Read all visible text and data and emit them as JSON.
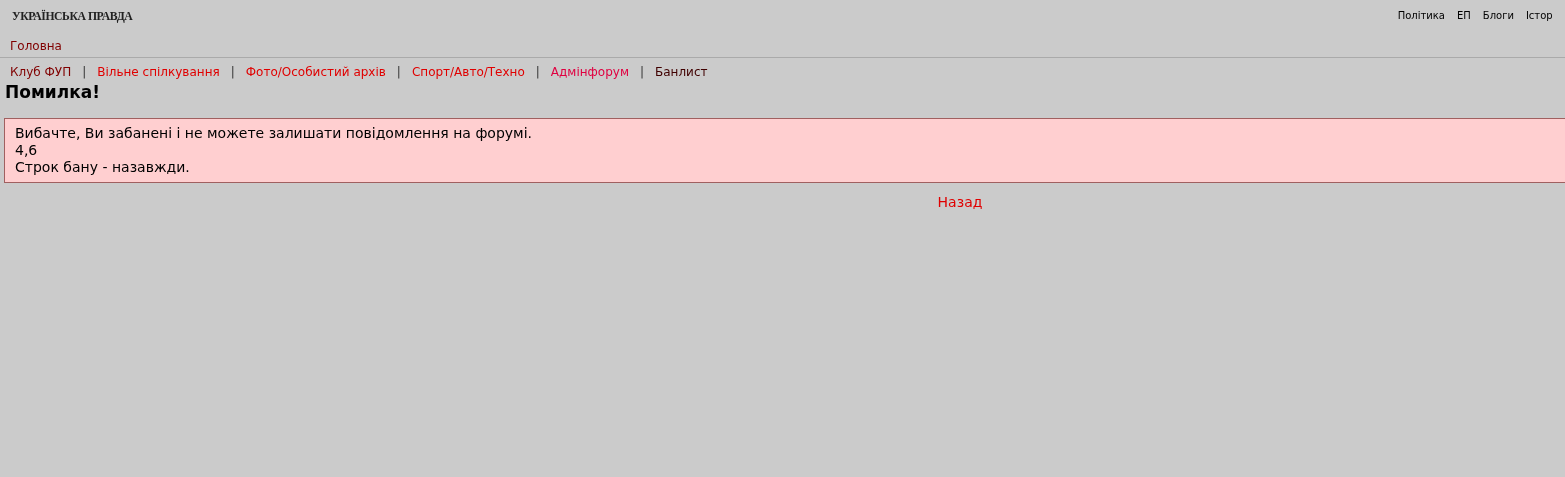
{
  "logo": "УКРАЇНСЬКА ПРАВДА",
  "top_nav": [
    "Політика",
    "ЕП",
    "Блоги",
    "Істор"
  ],
  "home_link": "Головна",
  "forums": [
    {
      "label": "Клуб ФУП",
      "color": "#800000"
    },
    {
      "label": "Вільне спілкування",
      "color": "#e00000"
    },
    {
      "label": "Фото/Особистий архів",
      "color": "#e00000"
    },
    {
      "label": "Спорт/Авто/Техно",
      "color": "#e00000"
    },
    {
      "label": "Адмінфорум",
      "color": "#e00040"
    },
    {
      "label": "Банлист",
      "color": "#400000"
    }
  ],
  "forum_separator": "|",
  "heading": "Помилка!",
  "error_lines": [
    "Вибачте, Ви забанені і не можете залишати повідомлення на форумі.",
    "4,6",
    "Строк бану - назавжди."
  ],
  "back_link": "Назад"
}
